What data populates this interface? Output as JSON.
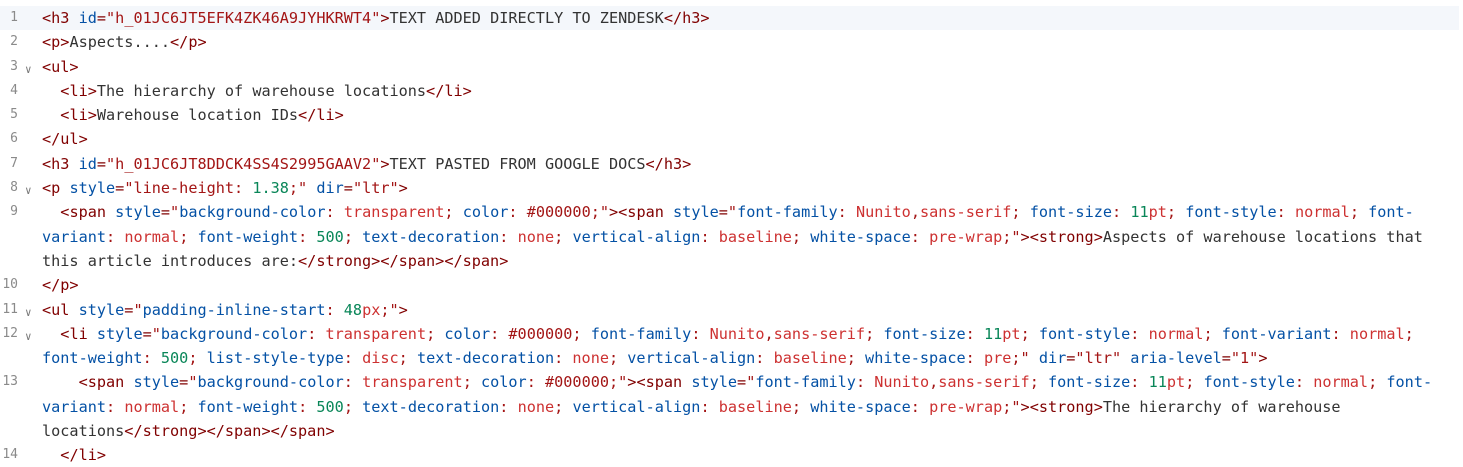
{
  "editor": {
    "lines": [
      {
        "num": "1",
        "fold": false,
        "active": true,
        "segs": [
          {
            "c": "b",
            "t": "<h3 "
          },
          {
            "c": "a",
            "t": "id"
          },
          {
            "c": "b",
            "t": "="
          },
          {
            "c": "s",
            "t": "\"h_01JC6JT5EFK4ZK46A9JYHKRWT4\""
          },
          {
            "c": "b",
            "t": ">"
          },
          {
            "c": "t",
            "t": "TEXT ADDED DIRECTLY TO ZENDESK"
          },
          {
            "c": "b",
            "t": "</h3>"
          }
        ]
      },
      {
        "num": "2",
        "fold": false,
        "segs": [
          {
            "c": "b",
            "t": "<p>"
          },
          {
            "c": "t",
            "t": "Aspects...."
          },
          {
            "c": "b",
            "t": "</p>"
          }
        ]
      },
      {
        "num": "3",
        "fold": true,
        "segs": [
          {
            "c": "b",
            "t": "<ul>"
          }
        ]
      },
      {
        "num": "4",
        "fold": false,
        "segs": [
          {
            "c": "t",
            "t": "  "
          },
          {
            "c": "b",
            "t": "<li>"
          },
          {
            "c": "t",
            "t": "The hierarchy of warehouse locations"
          },
          {
            "c": "b",
            "t": "</li>"
          }
        ]
      },
      {
        "num": "5",
        "fold": false,
        "segs": [
          {
            "c": "t",
            "t": "  "
          },
          {
            "c": "b",
            "t": "<li>"
          },
          {
            "c": "t",
            "t": "Warehouse location IDs"
          },
          {
            "c": "b",
            "t": "</li>"
          }
        ]
      },
      {
        "num": "6",
        "fold": false,
        "segs": [
          {
            "c": "b",
            "t": "</ul>"
          }
        ]
      },
      {
        "num": "7",
        "fold": false,
        "segs": [
          {
            "c": "b",
            "t": "<h3 "
          },
          {
            "c": "a",
            "t": "id"
          },
          {
            "c": "b",
            "t": "="
          },
          {
            "c": "s",
            "t": "\"h_01JC6JT8DDCK4SS4S2995GAAV2\""
          },
          {
            "c": "b",
            "t": ">"
          },
          {
            "c": "t",
            "t": "TEXT PASTED FROM GOOGLE DOCS"
          },
          {
            "c": "b",
            "t": "</h3>"
          }
        ]
      },
      {
        "num": "8",
        "fold": true,
        "segs": [
          {
            "c": "b",
            "t": "<p "
          },
          {
            "c": "a",
            "t": "style"
          },
          {
            "c": "b",
            "t": "="
          },
          {
            "c": "s",
            "t": "\"line-height: "
          },
          {
            "c": "n",
            "t": "1.38"
          },
          {
            "c": "s",
            "t": ";\""
          },
          {
            "c": "t",
            "t": " "
          },
          {
            "c": "a",
            "t": "dir"
          },
          {
            "c": "b",
            "t": "="
          },
          {
            "c": "s",
            "t": "\"ltr\""
          },
          {
            "c": "b",
            "t": ">"
          }
        ]
      },
      {
        "num": "9",
        "fold": false,
        "segs": [
          {
            "c": "t",
            "t": "  "
          },
          {
            "c": "b",
            "t": "<span "
          },
          {
            "c": "a",
            "t": "style"
          },
          {
            "c": "b",
            "t": "="
          },
          {
            "c": "s",
            "t": "\""
          },
          {
            "c": "a",
            "t": "background-color"
          },
          {
            "c": "s",
            "t": ": "
          },
          {
            "c": "k",
            "t": "transparent"
          },
          {
            "c": "s",
            "t": "; "
          },
          {
            "c": "a",
            "t": "color"
          },
          {
            "c": "s",
            "t": ": #000000;\""
          },
          {
            "c": "b",
            "t": "><span "
          },
          {
            "c": "a",
            "t": "style"
          },
          {
            "c": "b",
            "t": "="
          },
          {
            "c": "s",
            "t": "\""
          },
          {
            "c": "a",
            "t": "font-family"
          },
          {
            "c": "s",
            "t": ": "
          },
          {
            "c": "k",
            "t": "Nunito"
          },
          {
            "c": "s",
            "t": ","
          },
          {
            "c": "k",
            "t": "sans-serif"
          },
          {
            "c": "s",
            "t": "; "
          },
          {
            "c": "a",
            "t": "font-size"
          },
          {
            "c": "s",
            "t": ": "
          },
          {
            "c": "n",
            "t": "11"
          },
          {
            "c": "k",
            "t": "pt"
          },
          {
            "c": "s",
            "t": "; "
          },
          {
            "c": "a",
            "t": "font-style"
          },
          {
            "c": "s",
            "t": ": "
          },
          {
            "c": "k",
            "t": "normal"
          },
          {
            "c": "s",
            "t": "; "
          },
          {
            "c": "a",
            "t": "font-variant"
          },
          {
            "c": "s",
            "t": ": "
          },
          {
            "c": "k",
            "t": "normal"
          },
          {
            "c": "s",
            "t": "; "
          },
          {
            "c": "a",
            "t": "font-weight"
          },
          {
            "c": "s",
            "t": ": "
          },
          {
            "c": "n",
            "t": "500"
          },
          {
            "c": "s",
            "t": "; "
          },
          {
            "c": "a",
            "t": "text-decoration"
          },
          {
            "c": "s",
            "t": ": "
          },
          {
            "c": "k",
            "t": "none"
          },
          {
            "c": "s",
            "t": "; "
          },
          {
            "c": "a",
            "t": "vertical-align"
          },
          {
            "c": "s",
            "t": ": "
          },
          {
            "c": "k",
            "t": "baseline"
          },
          {
            "c": "s",
            "t": "; "
          },
          {
            "c": "a",
            "t": "white-space"
          },
          {
            "c": "s",
            "t": ": "
          },
          {
            "c": "k",
            "t": "pre-wrap"
          },
          {
            "c": "s",
            "t": ";\""
          },
          {
            "c": "b",
            "t": "><strong>"
          },
          {
            "c": "t",
            "t": "Aspects of warehouse locations that this article introduces are:"
          },
          {
            "c": "b",
            "t": "</strong></span></span>"
          }
        ]
      },
      {
        "num": "10",
        "fold": false,
        "segs": [
          {
            "c": "b",
            "t": "</p>"
          }
        ]
      },
      {
        "num": "11",
        "fold": true,
        "segs": [
          {
            "c": "b",
            "t": "<ul "
          },
          {
            "c": "a",
            "t": "style"
          },
          {
            "c": "b",
            "t": "="
          },
          {
            "c": "s",
            "t": "\""
          },
          {
            "c": "a",
            "t": "padding-inline-start"
          },
          {
            "c": "s",
            "t": ": "
          },
          {
            "c": "n",
            "t": "48"
          },
          {
            "c": "k",
            "t": "px"
          },
          {
            "c": "s",
            "t": ";\""
          },
          {
            "c": "b",
            "t": ">"
          }
        ]
      },
      {
        "num": "12",
        "fold": true,
        "segs": [
          {
            "c": "t",
            "t": "  "
          },
          {
            "c": "b",
            "t": "<li "
          },
          {
            "c": "a",
            "t": "style"
          },
          {
            "c": "b",
            "t": "="
          },
          {
            "c": "s",
            "t": "\""
          },
          {
            "c": "a",
            "t": "background-color"
          },
          {
            "c": "s",
            "t": ": "
          },
          {
            "c": "k",
            "t": "transparent"
          },
          {
            "c": "s",
            "t": "; "
          },
          {
            "c": "a",
            "t": "color"
          },
          {
            "c": "s",
            "t": ": #000000; "
          },
          {
            "c": "a",
            "t": "font-family"
          },
          {
            "c": "s",
            "t": ": "
          },
          {
            "c": "k",
            "t": "Nunito"
          },
          {
            "c": "s",
            "t": ","
          },
          {
            "c": "k",
            "t": "sans-serif"
          },
          {
            "c": "s",
            "t": "; "
          },
          {
            "c": "a",
            "t": "font-size"
          },
          {
            "c": "s",
            "t": ": "
          },
          {
            "c": "n",
            "t": "11"
          },
          {
            "c": "k",
            "t": "pt"
          },
          {
            "c": "s",
            "t": "; "
          },
          {
            "c": "a",
            "t": "font-style"
          },
          {
            "c": "s",
            "t": ": "
          },
          {
            "c": "k",
            "t": "normal"
          },
          {
            "c": "s",
            "t": "; "
          },
          {
            "c": "a",
            "t": "font-variant"
          },
          {
            "c": "s",
            "t": ": "
          },
          {
            "c": "k",
            "t": "normal"
          },
          {
            "c": "s",
            "t": "; "
          },
          {
            "c": "a",
            "t": "font-weight"
          },
          {
            "c": "s",
            "t": ": "
          },
          {
            "c": "n",
            "t": "500"
          },
          {
            "c": "s",
            "t": "; "
          },
          {
            "c": "a",
            "t": "list-style-type"
          },
          {
            "c": "s",
            "t": ": "
          },
          {
            "c": "k",
            "t": "disc"
          },
          {
            "c": "s",
            "t": "; "
          },
          {
            "c": "a",
            "t": "text-decoration"
          },
          {
            "c": "s",
            "t": ": "
          },
          {
            "c": "k",
            "t": "none"
          },
          {
            "c": "s",
            "t": "; "
          },
          {
            "c": "a",
            "t": "vertical-align"
          },
          {
            "c": "s",
            "t": ": "
          },
          {
            "c": "k",
            "t": "baseline"
          },
          {
            "c": "s",
            "t": "; "
          },
          {
            "c": "a",
            "t": "white-space"
          },
          {
            "c": "s",
            "t": ": "
          },
          {
            "c": "k",
            "t": "pre"
          },
          {
            "c": "s",
            "t": ";\""
          },
          {
            "c": "t",
            "t": " "
          },
          {
            "c": "a",
            "t": "dir"
          },
          {
            "c": "b",
            "t": "="
          },
          {
            "c": "s",
            "t": "\"ltr\""
          },
          {
            "c": "t",
            "t": " "
          },
          {
            "c": "a",
            "t": "aria-level"
          },
          {
            "c": "b",
            "t": "="
          },
          {
            "c": "s",
            "t": "\"1\""
          },
          {
            "c": "b",
            "t": ">"
          }
        ]
      },
      {
        "num": "13",
        "fold": false,
        "segs": [
          {
            "c": "t",
            "t": "    "
          },
          {
            "c": "b",
            "t": "<span "
          },
          {
            "c": "a",
            "t": "style"
          },
          {
            "c": "b",
            "t": "="
          },
          {
            "c": "s",
            "t": "\""
          },
          {
            "c": "a",
            "t": "background-color"
          },
          {
            "c": "s",
            "t": ": "
          },
          {
            "c": "k",
            "t": "transparent"
          },
          {
            "c": "s",
            "t": "; "
          },
          {
            "c": "a",
            "t": "color"
          },
          {
            "c": "s",
            "t": ": #000000;\""
          },
          {
            "c": "b",
            "t": "><span "
          },
          {
            "c": "a",
            "t": "style"
          },
          {
            "c": "b",
            "t": "="
          },
          {
            "c": "s",
            "t": "\""
          },
          {
            "c": "a",
            "t": "font-family"
          },
          {
            "c": "s",
            "t": ": "
          },
          {
            "c": "k",
            "t": "Nunito"
          },
          {
            "c": "s",
            "t": ","
          },
          {
            "c": "k",
            "t": "sans-serif"
          },
          {
            "c": "s",
            "t": "; "
          },
          {
            "c": "a",
            "t": "font-size"
          },
          {
            "c": "s",
            "t": ": "
          },
          {
            "c": "n",
            "t": "11"
          },
          {
            "c": "k",
            "t": "pt"
          },
          {
            "c": "s",
            "t": "; "
          },
          {
            "c": "a",
            "t": "font-style"
          },
          {
            "c": "s",
            "t": ": "
          },
          {
            "c": "k",
            "t": "normal"
          },
          {
            "c": "s",
            "t": "; "
          },
          {
            "c": "a",
            "t": "font-variant"
          },
          {
            "c": "s",
            "t": ": "
          },
          {
            "c": "k",
            "t": "normal"
          },
          {
            "c": "s",
            "t": "; "
          },
          {
            "c": "a",
            "t": "font-weight"
          },
          {
            "c": "s",
            "t": ": "
          },
          {
            "c": "n",
            "t": "500"
          },
          {
            "c": "s",
            "t": "; "
          },
          {
            "c": "a",
            "t": "text-decoration"
          },
          {
            "c": "s",
            "t": ": "
          },
          {
            "c": "k",
            "t": "none"
          },
          {
            "c": "s",
            "t": "; "
          },
          {
            "c": "a",
            "t": "vertical-align"
          },
          {
            "c": "s",
            "t": ": "
          },
          {
            "c": "k",
            "t": "baseline"
          },
          {
            "c": "s",
            "t": "; "
          },
          {
            "c": "a",
            "t": "white-space"
          },
          {
            "c": "s",
            "t": ": "
          },
          {
            "c": "k",
            "t": "pre-wrap"
          },
          {
            "c": "s",
            "t": ";\""
          },
          {
            "c": "b",
            "t": "><strong>"
          },
          {
            "c": "t",
            "t": "The hierarchy of warehouse locations"
          },
          {
            "c": "b",
            "t": "</strong></span></span>"
          }
        ]
      },
      {
        "num": "14",
        "fold": false,
        "segs": [
          {
            "c": "t",
            "t": "  "
          },
          {
            "c": "b",
            "t": "</li>"
          }
        ]
      }
    ]
  },
  "colors": {
    "tag": "#800000",
    "attribute": "#0451a5",
    "string": "#a31515",
    "number": "#098658",
    "keyword": "#cd3131",
    "text": "#333333",
    "line_number": "#8a8a8a",
    "active_line": "#f4f7fb"
  },
  "icons": {
    "fold": "chevron-down-icon"
  }
}
